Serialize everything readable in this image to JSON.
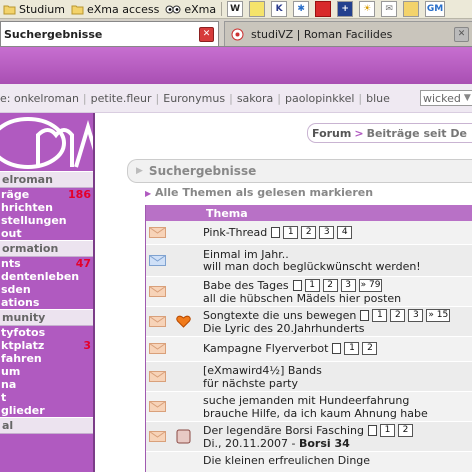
{
  "bookmarks": [
    {
      "label": "Studium",
      "icon": "folder-icon"
    },
    {
      "label": "eXma access",
      "icon": "folder-icon"
    },
    {
      "label": "eXma",
      "icon": "exma-eyes-icon"
    }
  ],
  "bookmark_icons": [
    "W",
    "K",
    "GM"
  ],
  "tabs": [
    {
      "title": "Suchergebnisse",
      "active": true
    },
    {
      "title": "studiVZ | Roman Facilides",
      "active": false
    }
  ],
  "online": {
    "prefix": "e: onkelroman",
    "users": [
      "petite.fleur",
      "Euronymus",
      "sakora",
      "paolopinkkel",
      "blue"
    ],
    "select_value": "wicked"
  },
  "sidebar": {
    "sections": [
      {
        "head": "elroman",
        "items": [
          {
            "label": "räge",
            "count": "186"
          },
          {
            "label": "hrichten",
            "count": ""
          },
          {
            "label": "stellungen",
            "count": ""
          },
          {
            "label": "out",
            "count": ""
          }
        ]
      },
      {
        "head": "ormation",
        "items": [
          {
            "label": "nts",
            "count": "47"
          },
          {
            "label": "dentenleben",
            "count": ""
          },
          {
            "label": "sden",
            "count": ""
          },
          {
            "label": "ations",
            "count": ""
          }
        ]
      },
      {
        "head": "munity",
        "items": [
          {
            "label": "tyfotos",
            "count": ""
          },
          {
            "label": "ktplatz",
            "count": "3"
          },
          {
            "label": "fahren",
            "count": ""
          },
          {
            "label": "um",
            "count": ""
          },
          {
            "label": "na",
            "count": ""
          },
          {
            "label": "t",
            "count": ""
          },
          {
            "label": "glieder",
            "count": ""
          }
        ]
      },
      {
        "head": "al",
        "items": []
      }
    ]
  },
  "breadcrumb": {
    "crumb1": "Forum",
    "arrow": ">",
    "crumb2": "Beiträge seit De"
  },
  "section_title": "Suchergebnisse",
  "mark_all_read": "Alle Themen als gelesen markieren",
  "table": {
    "header": "Thema",
    "rows": [
      {
        "title": "Pink-Thread",
        "subtitle": "",
        "pages": [
          "1",
          "2",
          "3",
          "4"
        ],
        "icon": "envelope-icon",
        "extra": ""
      },
      {
        "title": "Einmal im Jahr..",
        "subtitle": "will man doch beglückwünscht werden!",
        "pages": [],
        "icon": "envelope-blue-icon",
        "extra": ""
      },
      {
        "title": "Babe des Tages",
        "subtitle": "all die hübschen Mädels hier posten",
        "pages": [
          "1",
          "2",
          "3",
          "» 79"
        ],
        "icon": "envelope-icon",
        "extra": ""
      },
      {
        "title": "Songtexte die uns bewegen",
        "subtitle": "Die Lyric des 20.Jahrhunderts",
        "pages": [
          "1",
          "2",
          "3",
          "» 15"
        ],
        "icon": "envelope-icon",
        "extra": "heart-icon"
      },
      {
        "title": "Kampagne Flyerverbot",
        "subtitle": "",
        "pages": [
          "1",
          "2"
        ],
        "icon": "envelope-icon",
        "extra": ""
      },
      {
        "title": "[eXmawird4½] Bands",
        "subtitle": "für nächste party",
        "pages": [],
        "icon": "envelope-icon",
        "extra": ""
      },
      {
        "title": "suche jemanden mit Hundeerfahrung",
        "subtitle": "brauche Hilfe, da ich kaum Ahnung habe",
        "pages": [],
        "icon": "envelope-icon",
        "extra": ""
      },
      {
        "title": "Der legendäre Borsi Fasching",
        "subtitle_plain": "Di., 20.11.2007 - ",
        "subtitle_bold": "Borsi 34",
        "pages": [
          "1",
          "2"
        ],
        "icon": "envelope-icon",
        "extra": "square-icon"
      },
      {
        "title": "Die kleinen erfreulichen Dinge",
        "subtitle": "",
        "pages": [],
        "icon": "envelope-icon",
        "extra": ""
      }
    ]
  },
  "colors": {
    "accent": "#b05ac0",
    "header_band": "#a94fb3",
    "count_red": "#e4002b"
  }
}
